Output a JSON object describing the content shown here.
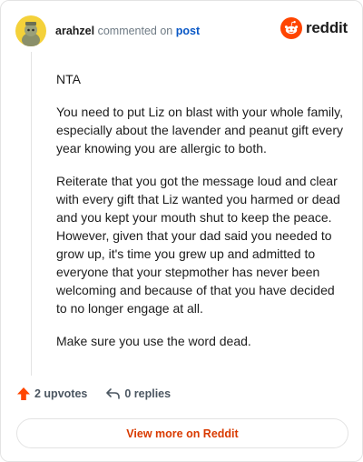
{
  "comment": {
    "author": "arahzel",
    "action_text": "commented on",
    "post_link_text": "post",
    "paragraphs": [
      "NTA",
      "You need to put Liz on blast with your whole family, especially about the lavender and peanut gift every year knowing you are allergic to both.",
      "Reiterate that you got the message loud and clear with every gift that Liz wanted you harmed or dead and you kept your mouth shut to keep the peace. However, given that your dad said you needed to grow up, it's time you grew up and admitted to everyone that your stepmother has never been welcoming and because of that you have decided to no longer engage at all.",
      "Make sure you use the word dead."
    ],
    "upvotes_text": "2 upvotes",
    "replies_text": "0 replies"
  },
  "branding": {
    "logo_text": "reddit",
    "logo_icon": "reddit-snoo-icon",
    "accent_color": "#ff4500"
  },
  "footer": {
    "view_more_label": "View more on Reddit"
  },
  "colors": {
    "upvote_icon": "#ff4500",
    "link": "#0a58c6",
    "view_more_text": "#d93a00",
    "avatar_bg": "#f4d13a"
  }
}
